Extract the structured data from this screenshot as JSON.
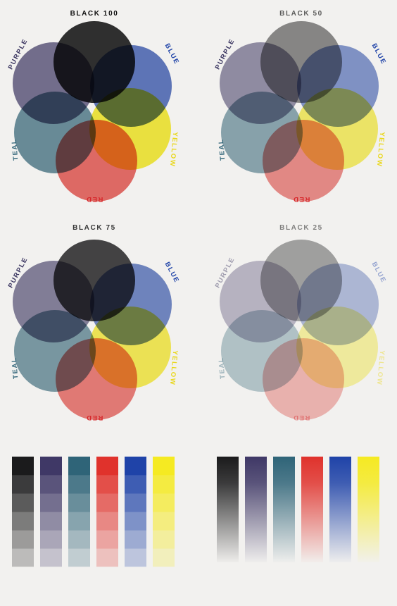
{
  "colors": {
    "black": "#1b1b1c",
    "purple": "#3f3866",
    "blue": "#1f43a8",
    "yellow": "#f5ea22",
    "red": "#e0322c",
    "teal": "#2f6478",
    "background": "#f2f1ef"
  },
  "label_colors": {
    "black": "#111111",
    "purple": "#3a3560",
    "blue": "#1f43a8",
    "yellow": "#e9d71a",
    "red": "#d7262a",
    "teal": "#2f6478"
  },
  "panels": [
    {
      "title": "BLACK 100",
      "black_level": 1.0,
      "labels": {
        "purple": "PURPLE",
        "blue": "BLUE",
        "yellow": "YELLOW",
        "red": "RED",
        "teal": "TEAL"
      }
    },
    {
      "title": "BLACK 50",
      "black_level": 0.5,
      "labels": {
        "purple": "PURPLE",
        "blue": "BLUE",
        "yellow": "YELLOW",
        "red": "RED",
        "teal": "TEAL"
      }
    },
    {
      "title": "BLACK 75",
      "black_level": 0.75,
      "labels": {
        "purple": "PURPLE",
        "blue": "BLUE",
        "yellow": "YELLOW",
        "red": "RED",
        "teal": "TEAL"
      }
    },
    {
      "title": "BLACK 25",
      "black_level": 0.25,
      "labels": {
        "purple": "PURPLE",
        "blue": "BLUE",
        "yellow": "YELLOW",
        "red": "RED",
        "teal": "TEAL"
      }
    }
  ],
  "swatch_sets": [
    {
      "style": "stepped",
      "order": [
        "black",
        "purple",
        "teal",
        "red",
        "blue",
        "yellow"
      ],
      "steps": [
        1.0,
        0.85,
        0.7,
        0.55,
        0.4,
        0.25
      ]
    },
    {
      "style": "gradient",
      "order": [
        "black",
        "purple",
        "teal",
        "red",
        "blue",
        "yellow"
      ]
    }
  ]
}
